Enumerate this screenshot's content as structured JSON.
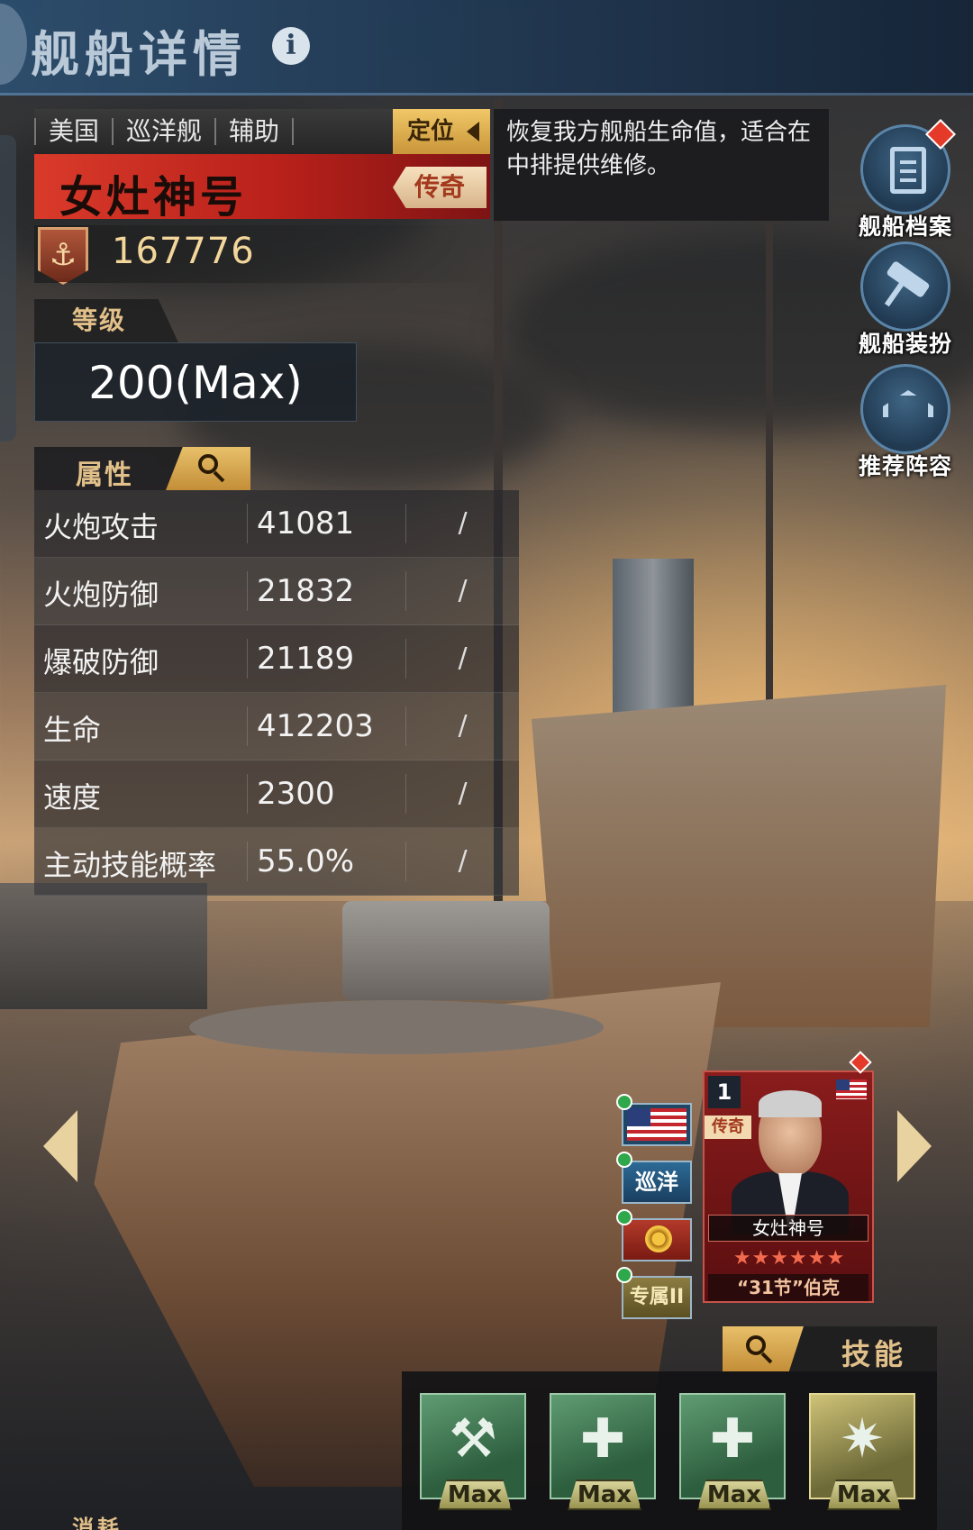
{
  "header": {
    "title": "舰船详情",
    "info_glyph": "i"
  },
  "ship": {
    "tags": [
      "美国",
      "巡洋舰",
      "辅助"
    ],
    "role_label": "定位",
    "role_description": "恢复我方舰船生命值，适合在中排提供维修。",
    "name": "女灶神号",
    "rarity": "传奇",
    "power_icon": "anchor-icon",
    "power": "167776",
    "level_label": "等级",
    "level": "200(Max)"
  },
  "attributes": {
    "title": "属性",
    "rows": [
      {
        "name": "火炮攻击",
        "value": "41081",
        "extra": "/"
      },
      {
        "name": "火炮防御",
        "value": "21832",
        "extra": "/"
      },
      {
        "name": "爆破防御",
        "value": "21189",
        "extra": "/"
      },
      {
        "name": "生命",
        "value": "412203",
        "extra": "/"
      },
      {
        "name": "速度",
        "value": "2300",
        "extra": "/"
      },
      {
        "name": "主动技能概率",
        "value": "55.0%",
        "extra": "/"
      }
    ]
  },
  "side_buttons": [
    {
      "label": "舰船档案",
      "icon": "clipboard-icon",
      "has_alert": true
    },
    {
      "label": "舰船装扮",
      "icon": "paint-roller-icon",
      "has_alert": false
    },
    {
      "label": "推荐阵容",
      "icon": "chevron-rank-icon",
      "has_alert": false
    }
  ],
  "commander": {
    "slot_number": "1",
    "rarity": "传奇",
    "name": "女灶神号",
    "stars": "★★★★★★",
    "title": "“31节”伯克",
    "icons": [
      {
        "name": "us-flag-icon",
        "label": ""
      },
      {
        "name": "cruise-badge",
        "label": "巡洋"
      },
      {
        "name": "medal-icon",
        "label": ""
      },
      {
        "name": "exclusive-badge",
        "label": "专属II"
      }
    ]
  },
  "skills": {
    "title": "技能",
    "items": [
      {
        "icon": "wrench-screwdriver-icon",
        "glyph": "⚒",
        "level": "Max"
      },
      {
        "icon": "repair-ship-icon",
        "glyph": "✚",
        "level": "Max"
      },
      {
        "icon": "repair-wave-icon",
        "glyph": "✚",
        "level": "Max"
      },
      {
        "icon": "burst-percent-icon",
        "glyph": "✷",
        "level": "Max"
      }
    ]
  },
  "footer": {
    "partial_label": "消耗"
  },
  "colors": {
    "accent_gold": "#e2c08a",
    "rarity_red": "#d93a2a",
    "panel_dark": "#262626"
  }
}
